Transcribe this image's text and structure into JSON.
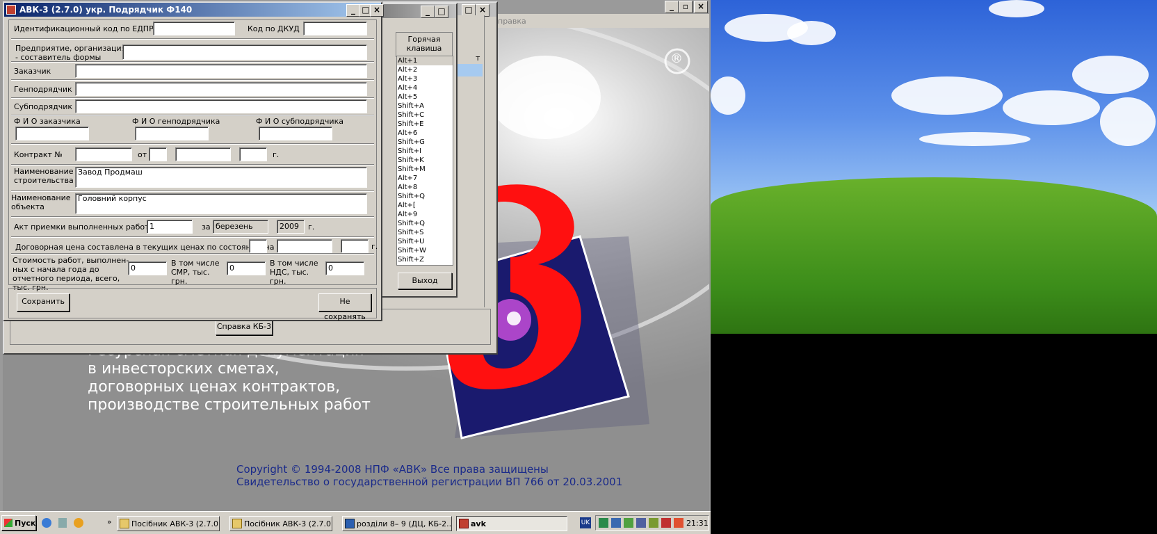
{
  "dialog": {
    "title": "АВК-3 (2.7.0)   укр.   Подрядчик         Ф140",
    "edrpou_label": "Идентификационный код по ЕДПРОУ",
    "edrpou_value": "",
    "dkud_label": "Код по ДКУД",
    "dkud_value": "",
    "enterprise_label": "Предприятие, организация - составитель формы",
    "enterprise_value": "",
    "customer_label": "Заказчик",
    "customer_value": "",
    "general_label": "Генподрядчик",
    "general_value": "",
    "sub_label": "Субподрядчик",
    "sub_value": "",
    "fio_customer_label": "Ф И О   заказчика",
    "fio_customer_value": "",
    "fio_general_label": "Ф И О   генподрядчика",
    "fio_general_value": "",
    "fio_sub_label": "Ф И О   субподрядчика",
    "fio_sub_value": "",
    "contract_label": "Контракт №",
    "contract_value": "",
    "contract_from_label": "от",
    "contract_day": "",
    "contract_month": "",
    "contract_year": "",
    "contract_year_suffix": "г.",
    "construction_label": "Наименование строительства",
    "construction_value": "Завод Продмаш",
    "object_label": "Наименование объекта",
    "object_value": "Головний корпус",
    "act_label": "Акт приемки выполненных работ №",
    "act_value": "1",
    "act_for_label": "за",
    "act_month": "березень",
    "act_year": "2009",
    "act_year_suffix": "г.",
    "price_label": "Договорная цена составлена в текущих ценах по состоянию на",
    "price_day": "",
    "price_month": "",
    "price_year": "",
    "price_year_suffix": "г.",
    "cost_label": "Стоимость работ, выполнен-ных с начала года до отчетного периода, всего, тыс. грн.",
    "cost_value": "0",
    "smr_label": "В том числе СМР, тыс. грн.",
    "smr_value": "0",
    "vat_label": "В том числе НДС, тыс. грн.",
    "vat_value": "0",
    "save_label": "Сохранить",
    "nosave_label": "Не сохранять"
  },
  "second_window": {
    "hotkey_header": "Горячая клавиша",
    "hotkeys": [
      "Alt+1",
      "Alt+2",
      "Alt+3",
      "Alt+4",
      "Alt+5",
      "Shift+A",
      "Shift+C",
      "Shift+E",
      "Alt+6",
      "Shift+G",
      "Shift+I",
      "Shift+K",
      "Shift+M",
      "Alt+7",
      "Alt+8",
      "Shift+Q",
      "Alt+[",
      "Alt+9",
      "Shift+Q",
      "Shift+S",
      "Shift+U",
      "Shift+W",
      "Shift+Z"
    ],
    "exit_label": "Выход",
    "partial_header": "т"
  },
  "third_window": {
    "help_button": "Справка КБ-3"
  },
  "main_window": {
    "menu_help": "правка",
    "logo_mark": "®",
    "digit": "3",
    "slogan": [
      "Ресурсная сметная документация",
      "в инвесторских сметах,",
      "договорных ценах контрактов,",
      "производстве строительных работ"
    ],
    "copyright": "Copyright ©  1994-2008 НПФ «АВК» Все права защищены",
    "certificate": "Свидетельство о государственной регистрации ВП   766 от 20.03.2001"
  },
  "taskbar": {
    "start_label": "Пуск",
    "tasks": [
      "Посібник АВК-3 (2.7.0)",
      "Посібник АВК-3 (2.7.0)",
      "розділи 8– 9 (ДЦ, КБ-2...",
      "avk"
    ],
    "language": "UK",
    "clock": "21:31"
  },
  "colors": {
    "title_active": "#0a246a",
    "face": "#d4d0c8",
    "red": "#ff1010",
    "navy": "#1a1a6e"
  }
}
